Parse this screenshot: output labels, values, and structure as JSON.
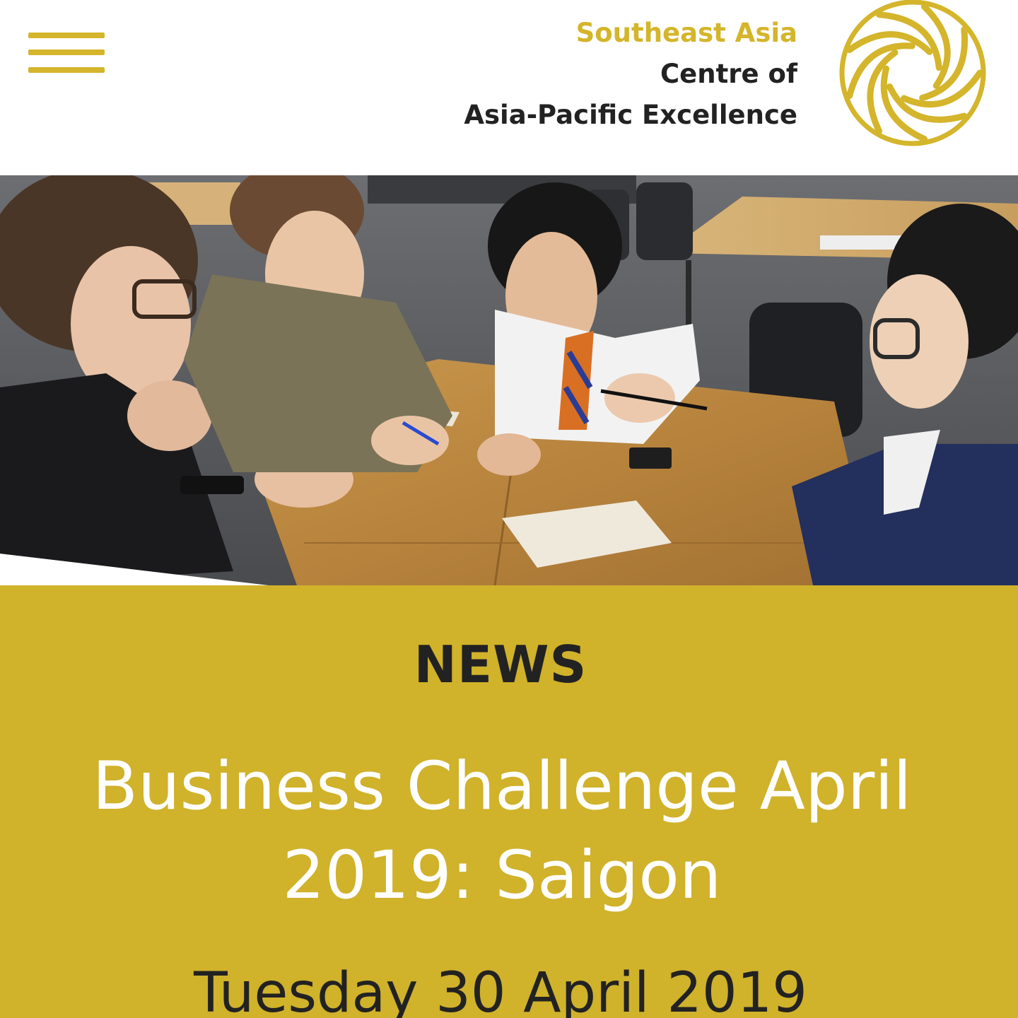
{
  "colors": {
    "brand_gold": "#d4b52b",
    "panel_gold": "#d0b22b",
    "dark_text": "#222222",
    "title_text": "#ffffff"
  },
  "header": {
    "menu_icon": "hamburger-menu-icon",
    "brand": {
      "line1": "Southeast Asia",
      "line2": "Centre of",
      "line3": "Asia-Pacific Excellence"
    },
    "logo_icon": "spiral-logo-icon"
  },
  "hero": {
    "image": "students-around-table-photo"
  },
  "article": {
    "section_label": "NEWS",
    "title": "Business Challenge April 2019: Saigon",
    "date": "Tuesday 30 April 2019"
  }
}
